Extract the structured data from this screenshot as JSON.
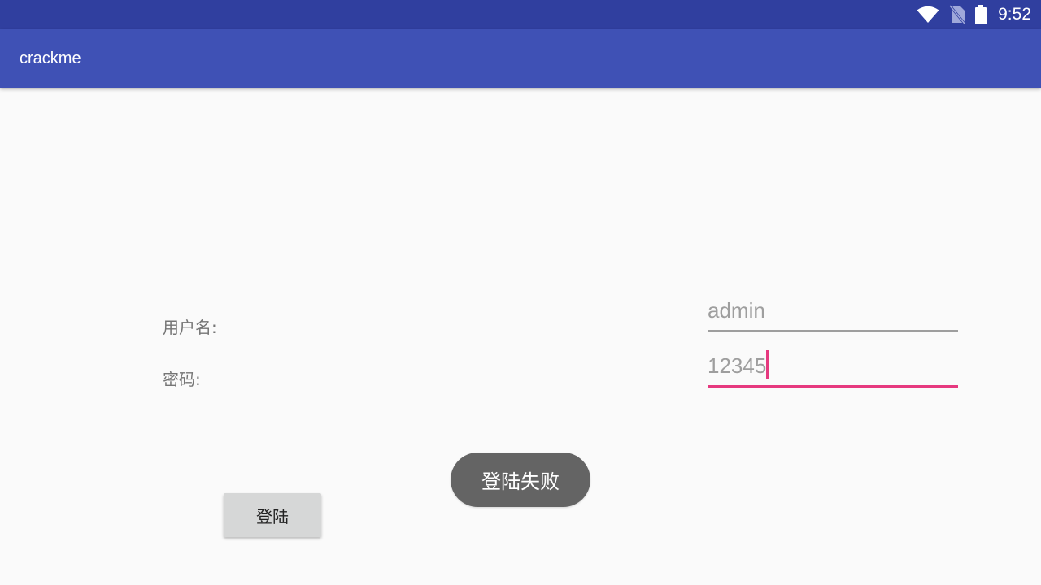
{
  "status_bar": {
    "time": "9:52",
    "icons": [
      "wifi-icon",
      "no-sim-icon",
      "battery-icon"
    ],
    "background": "#303f9f"
  },
  "app_bar": {
    "title": "crackme",
    "background": "#3f51b5"
  },
  "form": {
    "username_label": "用户名:",
    "username_value": "admin",
    "password_label": "密码:",
    "password_value": "12345",
    "accent_color": "#e6397f",
    "login_button": "登陆"
  },
  "toast": {
    "message": "登陆失败"
  }
}
